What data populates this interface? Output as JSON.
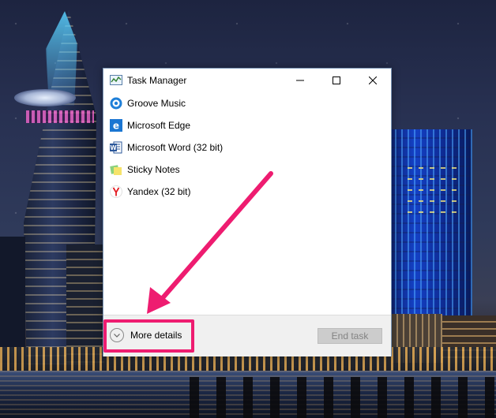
{
  "window": {
    "title": "Task Manager",
    "icon": "task-manager-icon",
    "controls": {
      "minimize": "minimize-icon",
      "maximize": "maximize-icon",
      "close": "close-icon"
    }
  },
  "apps": [
    {
      "label": "Groove Music",
      "icon": "groove-music-icon"
    },
    {
      "label": "Microsoft Edge",
      "icon": "edge-icon"
    },
    {
      "label": "Microsoft Word (32 bit)",
      "icon": "word-icon"
    },
    {
      "label": "Sticky Notes",
      "icon": "sticky-notes-icon"
    },
    {
      "label": "Yandex (32 bit)",
      "icon": "yandex-icon"
    }
  ],
  "footer": {
    "more_details": "More details",
    "end_task": "End task"
  },
  "annotation": {
    "color": "#ee1c70"
  }
}
